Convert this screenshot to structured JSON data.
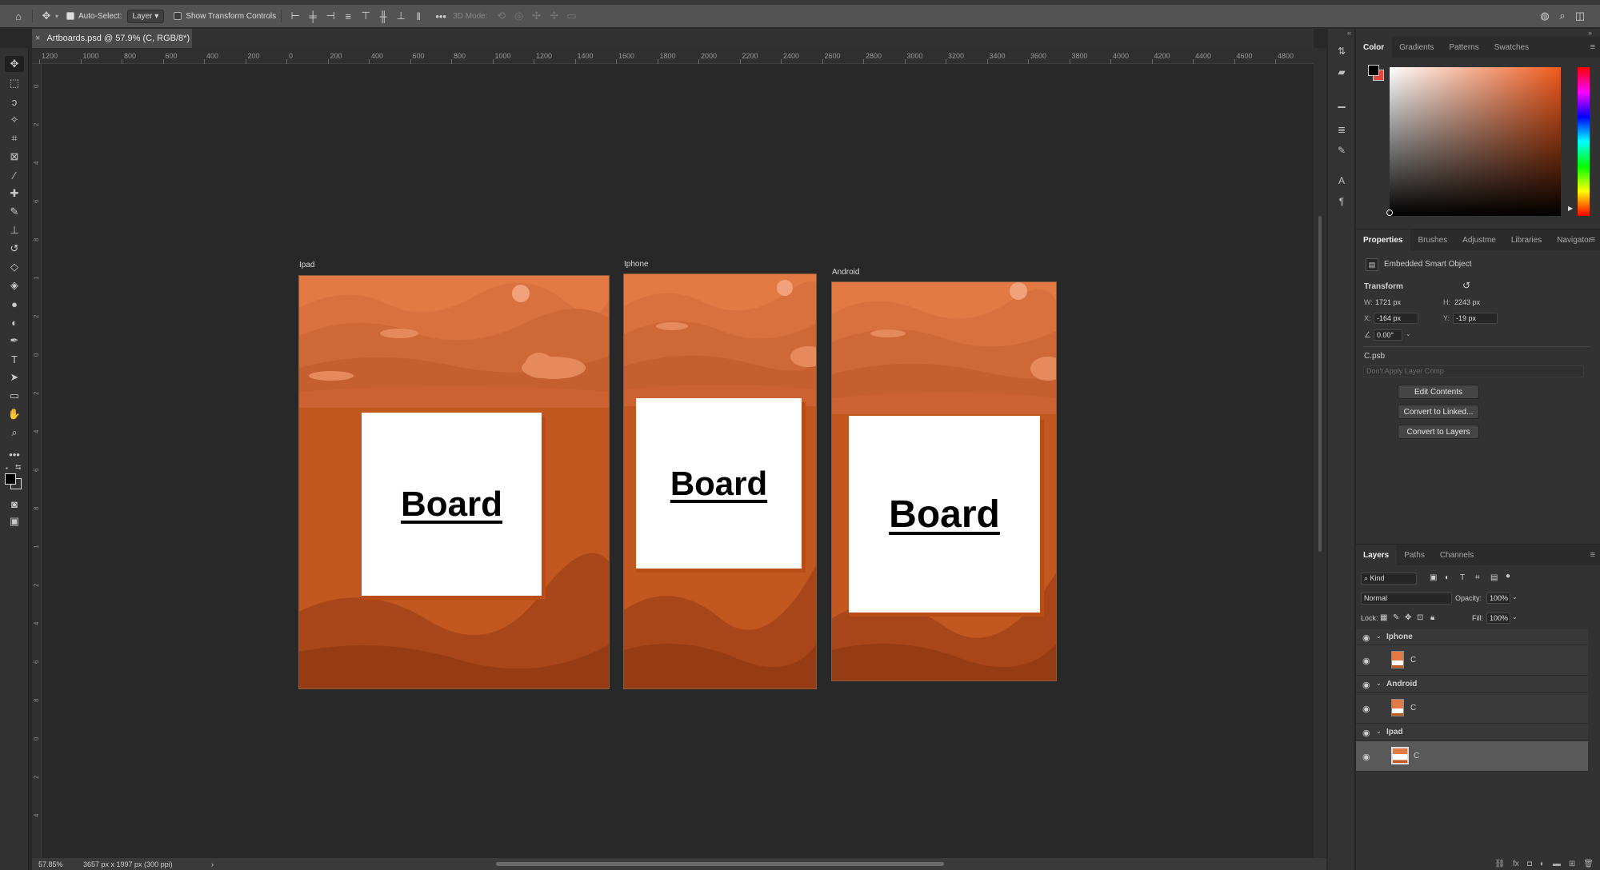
{
  "colors": {
    "canvas_bg": "#282828",
    "sky": "#e37a44",
    "card": "#ffffff",
    "accent_red": "#e3463a"
  },
  "options_bar": {
    "auto_select_label": "Auto-Select:",
    "auto_select_checked": true,
    "auto_select_target": "Layer",
    "show_transform_controls_label": "Show Transform Controls",
    "show_transform_controls_checked": false,
    "mode_3d_label": "3D Mode:"
  },
  "document": {
    "tab_title": "Artboards.psd @ 57.9% (C, RGB/8*)"
  },
  "ruler_top_labels": [
    "1200",
    "1000",
    "800",
    "600",
    "400",
    "200",
    "0",
    "200",
    "400",
    "600",
    "800",
    "1000",
    "1200",
    "1400",
    "1600",
    "1800",
    "2000",
    "2200",
    "2400",
    "2600",
    "2800",
    "3000",
    "3200",
    "3400",
    "3600",
    "3800",
    "4000",
    "4200",
    "4400",
    "4600",
    "4800"
  ],
  "ruler_left_labels": [
    "0",
    "2",
    "4",
    "6",
    "8",
    "1",
    "2",
    "0",
    "2",
    "4",
    "6",
    "8",
    "1",
    "2",
    "4",
    "6",
    "8",
    "0",
    "2",
    "4"
  ],
  "artboards": [
    {
      "label": "Ipad",
      "card_text": "Board"
    },
    {
      "label": "Iphone",
      "card_text": "Board"
    },
    {
      "label": "Android",
      "card_text": "Board"
    }
  ],
  "status": {
    "zoom": "57.85%",
    "doc_info": "3657 px x 1997 px (300 ppi)",
    "arrow": "›"
  },
  "color_panel": {
    "tabs": [
      "Color",
      "Gradients",
      "Patterns",
      "Swatches"
    ],
    "active_tab": "Color",
    "foreground": "#000000",
    "background": "#e3463a"
  },
  "properties_panel": {
    "tabs": [
      "Properties",
      "Brushes",
      "Adjustme",
      "Libraries",
      "Navigator"
    ],
    "active_tab": "Properties",
    "object_type": "Embedded Smart Object",
    "transform_label": "Transform",
    "w_label": "W:",
    "w_value": "1721 px",
    "h_label": "H:",
    "h_value": "2243 px",
    "x_label": "X:",
    "x_value": "-164 px",
    "y_label": "Y:",
    "y_value": "-19 px",
    "angle_value": "0.00°",
    "file_name": "C.psb",
    "layer_comp_placeholder": "Don't Apply Layer Comp",
    "buttons": [
      "Edit Contents",
      "Convert to Linked...",
      "Convert to Layers"
    ]
  },
  "layers_panel": {
    "tabs": [
      "Layers",
      "Paths",
      "Channels"
    ],
    "active_tab": "Layers",
    "filter_kind": "Kind",
    "blend_mode": "Normal",
    "opacity_label": "Opacity:",
    "opacity_value": "100%",
    "lock_label": "Lock:",
    "fill_label": "Fill:",
    "fill_value": "100%",
    "groups": [
      {
        "name": "Iphone",
        "child": "C"
      },
      {
        "name": "Android",
        "child": "C"
      },
      {
        "name": "Ipad",
        "child": "C"
      }
    ]
  }
}
